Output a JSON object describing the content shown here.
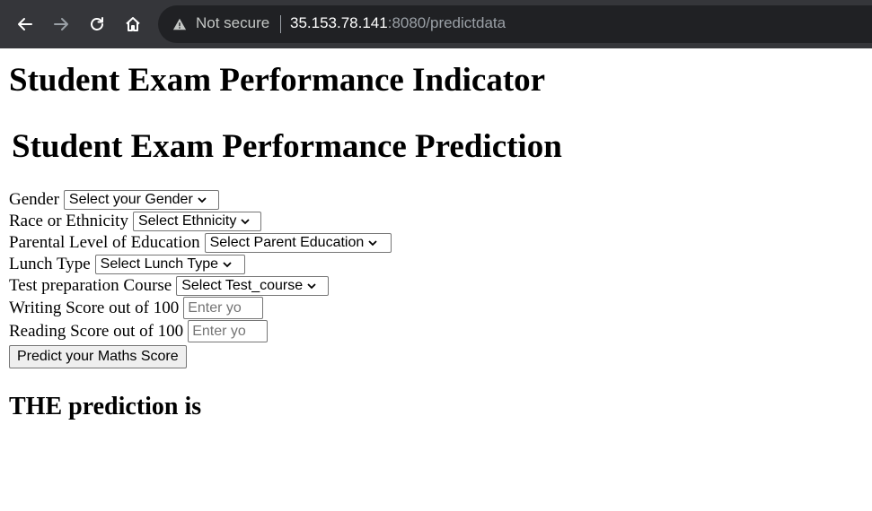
{
  "browser": {
    "security_label": "Not secure",
    "url_host": "35.153.78.141",
    "url_rest": ":8080/predictdata"
  },
  "page": {
    "title": "Student Exam Performance Indicator",
    "subtitle": "Student Exam Performance Prediction",
    "fields": {
      "gender": {
        "label": "Gender",
        "value": "Select your Gender"
      },
      "ethnicity": {
        "label": "Race or Ethnicity",
        "value": "Select Ethnicity"
      },
      "parental_education": {
        "label": "Parental Level of Education",
        "value": "Select Parent Education"
      },
      "lunch": {
        "label": "Lunch Type",
        "value": "Select Lunch Type"
      },
      "test_prep": {
        "label": "Test preparation Course",
        "value": "Select Test_course"
      },
      "writing_score": {
        "label": "Writing Score out of 100",
        "placeholder": "Enter yo"
      },
      "reading_score": {
        "label": "Reading Score out of 100",
        "placeholder": "Enter yo"
      }
    },
    "submit_label": "Predict your Maths Score",
    "result_label": "THE prediction is"
  },
  "icons": {
    "back": "arrow-left-icon",
    "forward": "arrow-right-icon",
    "reload": "reload-icon",
    "home": "home-icon",
    "warning": "warning-triangle-icon",
    "dropdown": "chevron-down-icon"
  },
  "colors": {
    "toolbar_bg": "#35363a",
    "omnibox_bg": "#202124",
    "url_host": "#ffffff",
    "url_dim": "#9aa0a6"
  }
}
